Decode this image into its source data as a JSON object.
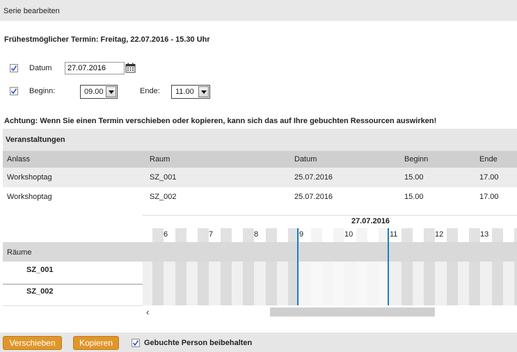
{
  "dialog": {
    "title": "Serie bearbeiten"
  },
  "earliest": {
    "text": "Frühestmöglicher Termin: Freitag, 22.07.2016 - 15.30 Uhr"
  },
  "form": {
    "date_label": "Datum",
    "date_value": "27.07.2016",
    "date_checked": true,
    "begin_label": "Beginn:",
    "begin_value": "09.00",
    "begin_checked": true,
    "end_label": "Ende:",
    "end_value": "11.00"
  },
  "warning": {
    "text": "Achtung: Wenn Sie einen Termin verschieben oder kopieren, kann sich das auf Ihre gebuchten Ressourcen auswirken!"
  },
  "events": {
    "title": "Veranstaltungen",
    "columns": [
      "Anlass",
      "Raum",
      "Datum",
      "Beginn",
      "Ende"
    ],
    "rows": [
      [
        "Workshoptag",
        "SZ_001",
        "25.07.2016",
        "15.00",
        "17.00"
      ],
      [
        "Workshoptag",
        "SZ_002",
        "25.07.2016",
        "15.00",
        "17.00"
      ]
    ]
  },
  "timeline": {
    "date": "27.07.2016",
    "hours": [
      "6",
      "7",
      "8",
      "9",
      "10",
      "11",
      "12",
      "13"
    ],
    "rooms_header": "Räume",
    "rooms": [
      "SZ_001",
      "SZ_002"
    ],
    "scroll_left_glyph": "‹"
  },
  "footer": {
    "move_label": "Verschieben",
    "copy_label": "Kopieren",
    "keep_person_label": "Gebuchte Person beibehalten",
    "keep_person_checked": true
  },
  "colors": {
    "accent_orange": "#e0962b",
    "marker_blue": "#1a7fc4"
  }
}
